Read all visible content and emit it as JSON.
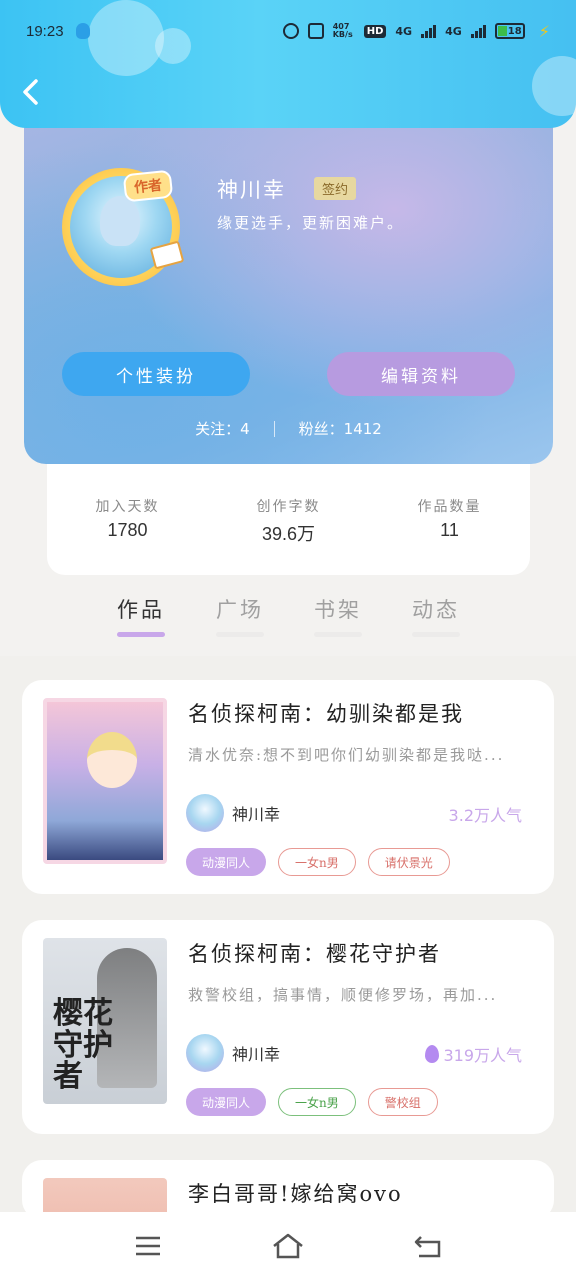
{
  "status": {
    "time": "19:23",
    "net_speed": "407 KB/s",
    "hd": "HD",
    "sig1": "4G",
    "sig2": "4G",
    "battery": "18"
  },
  "profile": {
    "author_badge": "作者",
    "name": "神川幸",
    "signed": "签约",
    "bio": "缘更选手，更新困难户。",
    "dress_button": "个性装扮",
    "edit_button": "编辑资料",
    "following": "关注：4",
    "fans": "粉丝：1412"
  },
  "stats": [
    {
      "label": "加入天数",
      "value": "1780"
    },
    {
      "label": "创作字数",
      "value": "39.6万"
    },
    {
      "label": "作品数量",
      "value": "11"
    }
  ],
  "tabs": [
    "作品",
    "广场",
    "书架",
    "动态"
  ],
  "books": [
    {
      "title": "名侦探柯南：幼驯染都是我",
      "desc": "清水优奈:想不到吧你们幼驯染都是我哒...",
      "author": "神川幸",
      "popularity": "3.2万人气",
      "tags": [
        "动漫同人",
        "一女n男",
        "请伏景光"
      ]
    },
    {
      "title": "名侦探柯南：樱花守护者",
      "desc": "救警校组，搞事情，顺便修罗场，再加...",
      "author": "神川幸",
      "popularity": "319万人气",
      "tags": [
        "动漫同人",
        "一女n男",
        "警校组"
      ],
      "cover_text": "樱花守护者"
    },
    {
      "title": "李白哥哥!嫁给窝ovo"
    }
  ]
}
